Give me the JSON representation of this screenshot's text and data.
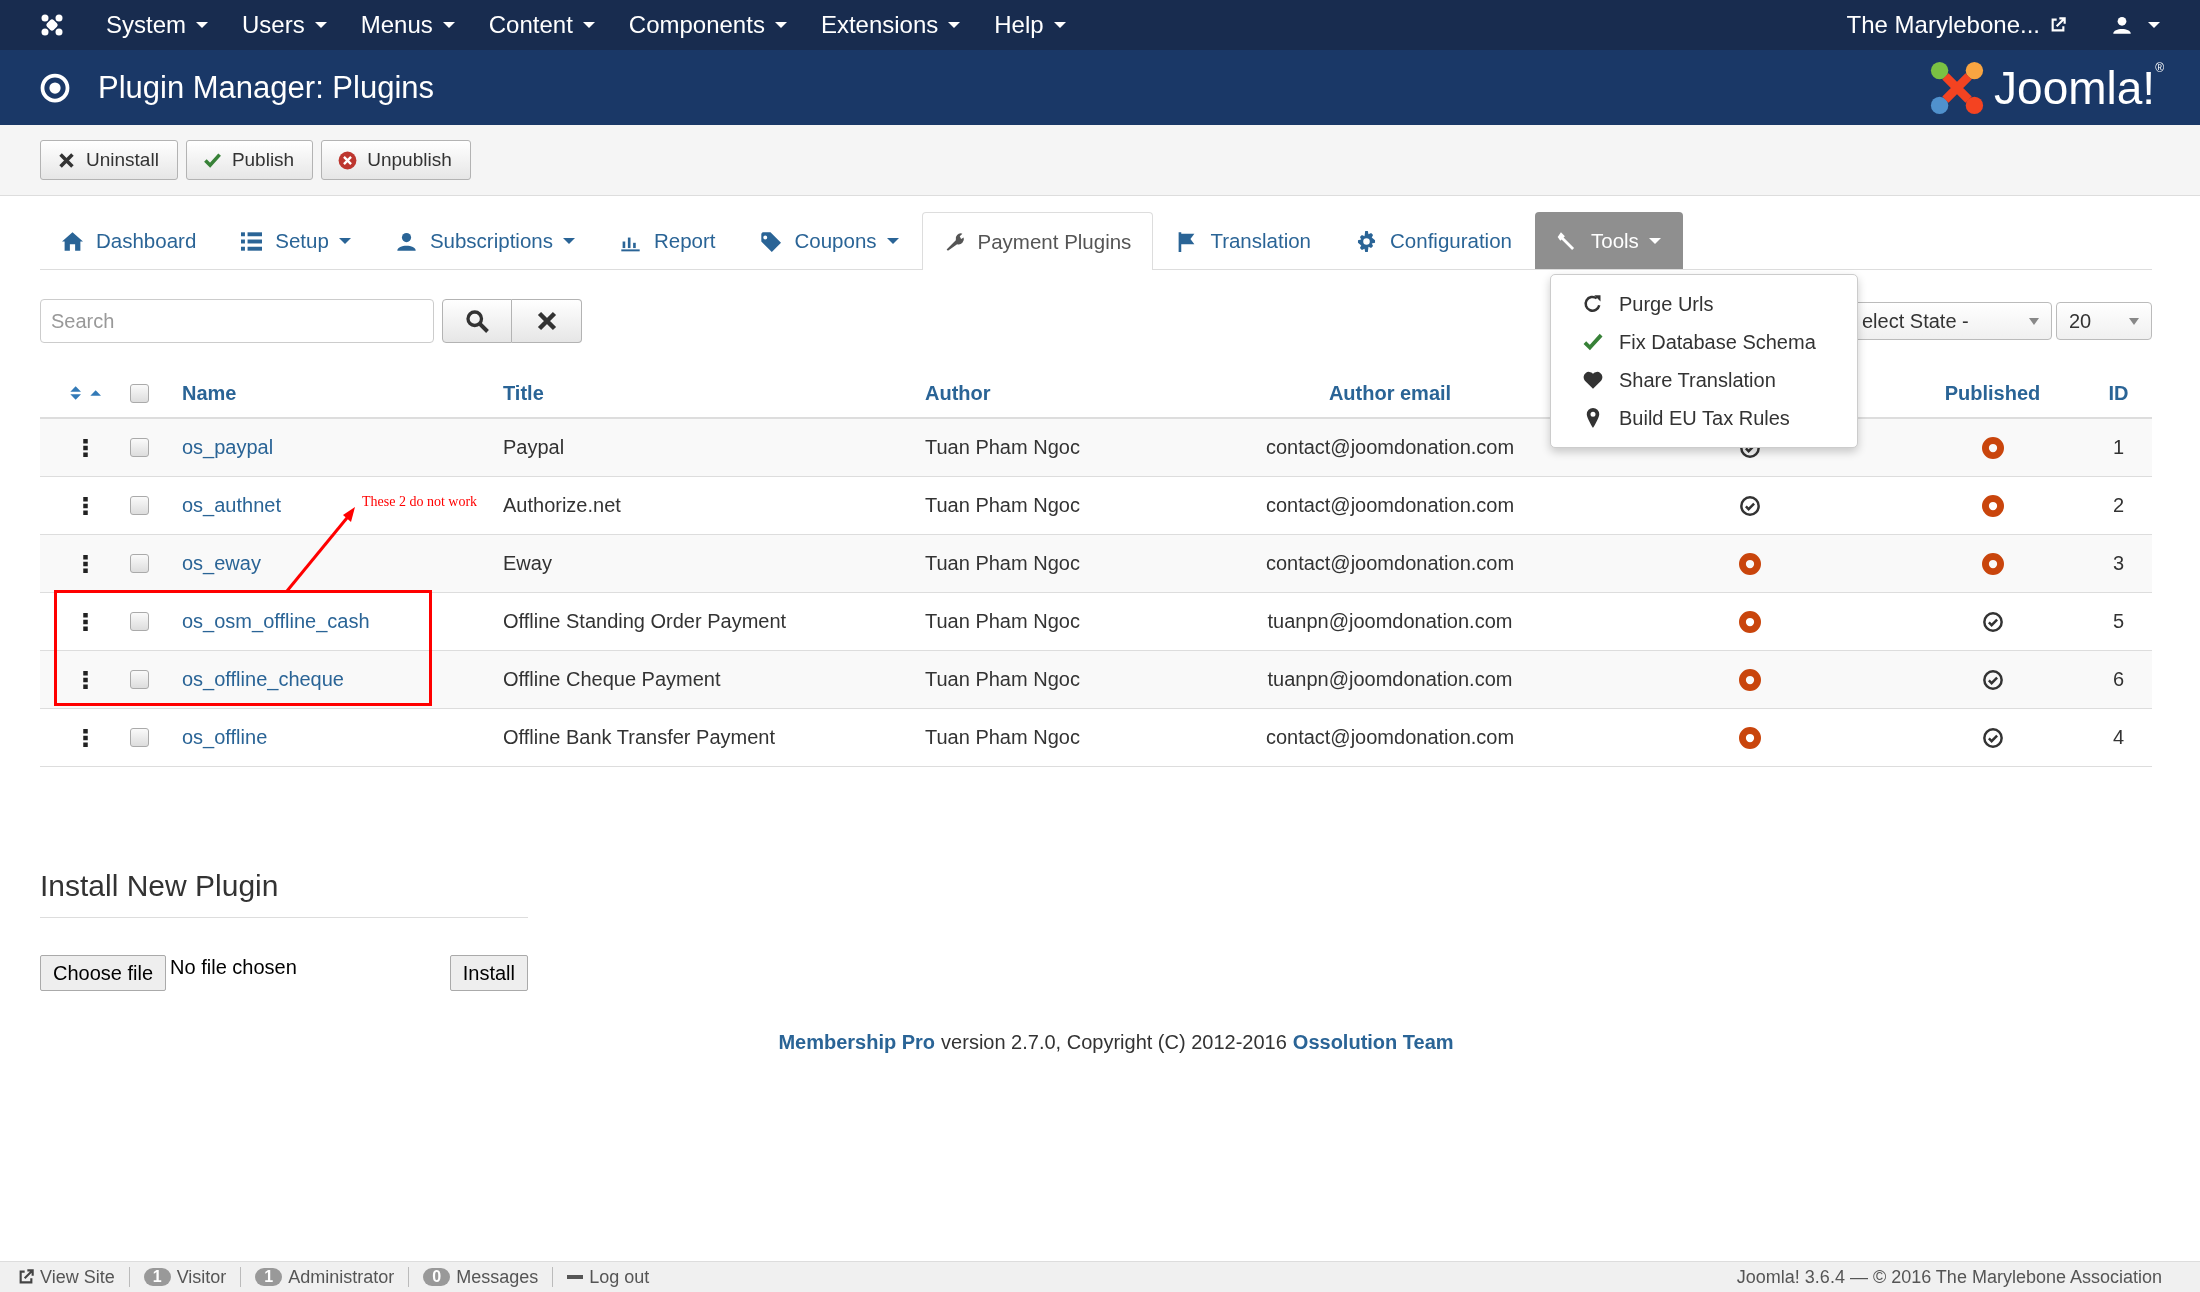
{
  "top_menu": [
    "System",
    "Users",
    "Menus",
    "Content",
    "Components",
    "Extensions",
    "Help"
  ],
  "site_link": "The Marylebone...",
  "page_title": "Plugin Manager: Plugins",
  "logo_text": "Joomla!$^{®}$",
  "toolbar": [
    {
      "label": "Uninstall",
      "kind": "uninstall"
    },
    {
      "label": "Publish",
      "kind": "publish"
    },
    {
      "label": "Unpublish",
      "kind": "unpublish"
    }
  ],
  "tabs": [
    {
      "label": "Dashboard",
      "kind": "home",
      "dropdown": false,
      "selected": false
    },
    {
      "label": "Setup",
      "kind": "list",
      "dropdown": true,
      "selected": false
    },
    {
      "label": "Subscriptions",
      "kind": "user",
      "dropdown": true,
      "selected": false
    },
    {
      "label": "Report",
      "kind": "chart",
      "dropdown": false,
      "selected": false
    },
    {
      "label": "Coupons",
      "kind": "tag",
      "dropdown": true,
      "selected": false
    },
    {
      "label": "Payment Plugins",
      "kind": "wrench",
      "dropdown": false,
      "selected": true
    },
    {
      "label": "Translation",
      "kind": "flag",
      "dropdown": false,
      "selected": false
    },
    {
      "label": "Configuration",
      "kind": "gear",
      "dropdown": false,
      "selected": false
    },
    {
      "label": "Tools",
      "kind": "tool",
      "dropdown": true,
      "selected": false,
      "open": true
    }
  ],
  "tools_menu": [
    {
      "label": "Purge Urls",
      "kind": "refresh"
    },
    {
      "label": "Fix Database Schema",
      "kind": "check"
    },
    {
      "label": "Share Translation",
      "kind": "heart"
    },
    {
      "label": "Build EU Tax Rules",
      "kind": "pin"
    }
  ],
  "search": {
    "placeholder": "Search"
  },
  "state_filter": {
    "value": "elect State -"
  },
  "page_size": {
    "value": "20"
  },
  "table": {
    "select_all_checked": false,
    "columns": [
      "Name",
      "Title",
      "Author",
      "Author email",
      "Published",
      "ID"
    ],
    "rows": [
      {
        "checked": false,
        "name": "os_paypal",
        "title": "Paypal",
        "author": "Tuan Pham Ngoc",
        "email": "contact@joomdonation.com",
        "column_6_on": true,
        "published": false,
        "id": "1"
      },
      {
        "checked": false,
        "name": "os_authnet",
        "title": "Authorize.net",
        "author": "Tuan Pham Ngoc",
        "email": "contact@joomdonation.com",
        "column_6_on": true,
        "published": false,
        "id": "2"
      },
      {
        "checked": false,
        "name": "os_eway",
        "title": "Eway",
        "author": "Tuan Pham Ngoc",
        "email": "contact@joomdonation.com",
        "column_6_on": false,
        "published": false,
        "id": "3"
      },
      {
        "checked": false,
        "name": "os_osm_offline_cash",
        "title": "Offline Standing Order Payment",
        "author": "Tuan Pham Ngoc",
        "email": "tuanpn@joomdonation.com",
        "column_6_on": false,
        "published": true,
        "id": "5"
      },
      {
        "checked": false,
        "name": "os_offline_cheque",
        "title": "Offline Cheque Payment",
        "author": "Tuan Pham Ngoc",
        "email": "tuanpn@joomdonation.com",
        "column_6_on": false,
        "published": true,
        "id": "6"
      },
      {
        "checked": false,
        "name": "os_offline",
        "title": "Offline Bank Transfer Payment",
        "author": "Tuan Pham Ngoc",
        "email": "contact@joomdonation.com",
        "column_6_on": false,
        "published": true,
        "id": "4"
      }
    ]
  },
  "annotation": "These 2 do not work",
  "install": {
    "heading": "Install New Plugin",
    "choose_button": "Choose file",
    "file_status": "No file chosen",
    "install_button": "Install"
  },
  "footer": {
    "product": "Membership Pro",
    "text": "version 2.7.0, Copyright (C) 2012-2016",
    "team": "Ossolution Team"
  },
  "status_bar": {
    "view_site": "View Site",
    "counters": [
      {
        "count": "1",
        "label": "Visitor"
      },
      {
        "count": "1",
        "label": "Administrator"
      },
      {
        "count": "0",
        "label": "Messages"
      }
    ],
    "logout": "Log out",
    "version": "Joomla! 3.6.4  —  © 2016 The Marylebone Association"
  }
}
